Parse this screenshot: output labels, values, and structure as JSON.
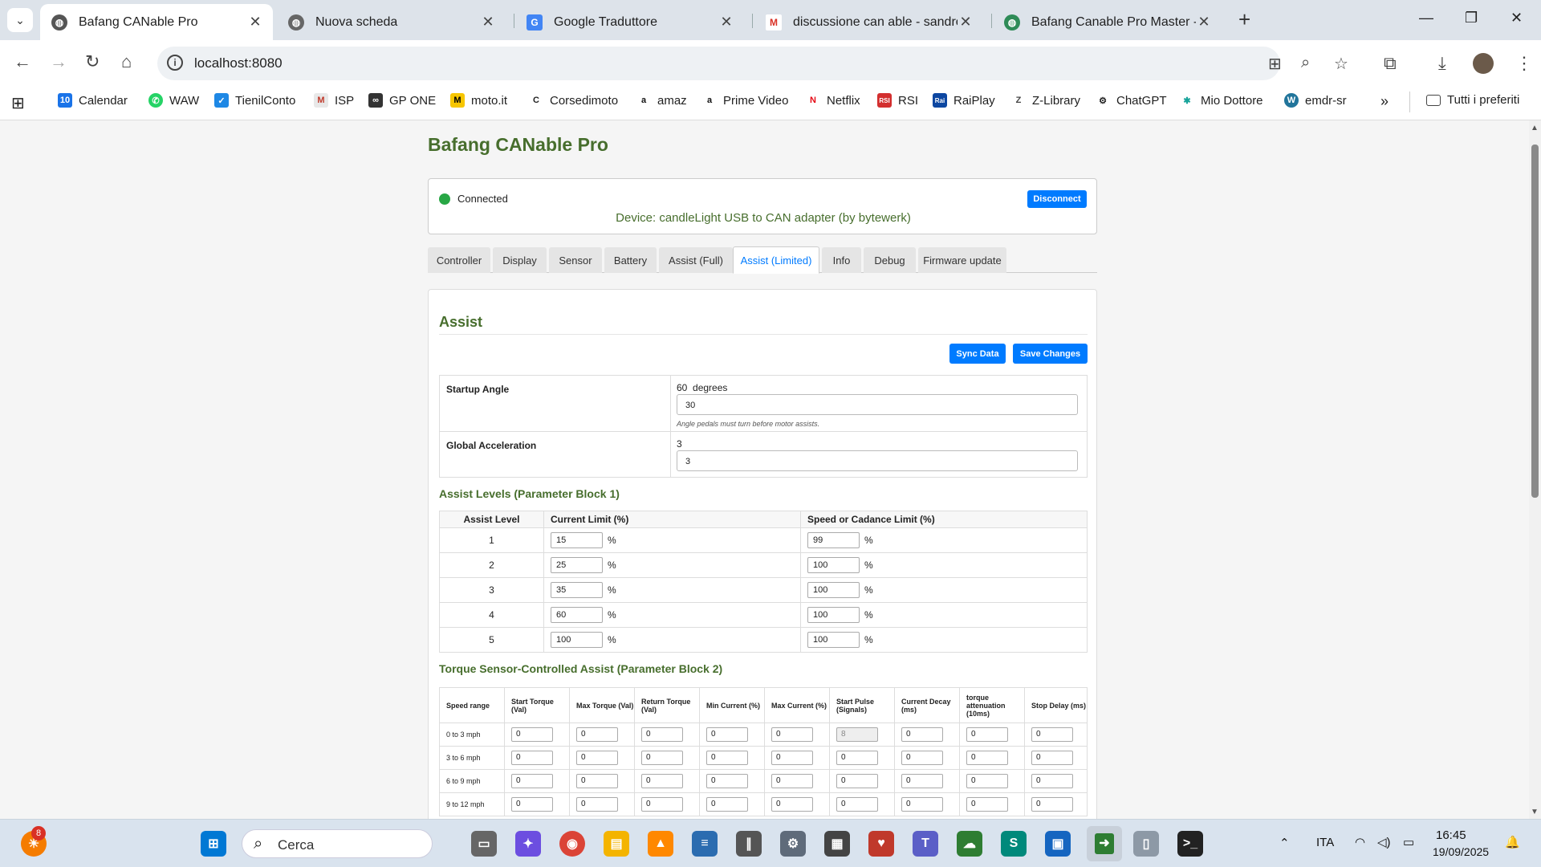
{
  "browser": {
    "tabs": [
      {
        "title": "Bafang CANable Pro",
        "active": true,
        "favicon": "globe-icon"
      },
      {
        "title": "Nuova scheda",
        "active": false,
        "favicon": "chrome-icon"
      },
      {
        "title": "Google Traduttore",
        "active": false,
        "favicon": "translate-icon"
      },
      {
        "title": "discussione can able - sandro.b",
        "active": false,
        "favicon": "gmail-icon"
      },
      {
        "title": "Bafang Canable Pro Master - di",
        "active": false,
        "favicon": "globe-icon"
      }
    ],
    "url": "localhost:8080",
    "bookmarks": [
      "Calendar",
      "WAW",
      "TienilConto",
      "ISP",
      "GP ONE",
      "moto.it",
      "Corsedimoto",
      "amaz",
      "Prime Video",
      "Netflix",
      "RSI",
      "RaiPlay",
      "Z-Library",
      "ChatGPT",
      "Mio Dottore",
      "emdr-sr"
    ],
    "all_bookmarks": "Tutti i preferiti"
  },
  "app": {
    "title": "Bafang CANable Pro",
    "status": "Connected",
    "device": "Device: candleLight USB to CAN adapter (by bytewerk)",
    "disconnect": "Disconnect",
    "tabs": [
      "Controller",
      "Display",
      "Sensor",
      "Battery",
      "Assist (Full)",
      "Assist (Limited)",
      "Info",
      "Debug",
      "Firmware update"
    ],
    "active_tab": "Assist (Limited)",
    "section_title": "Assist",
    "sync_label": "Sync Data",
    "save_label": "Save Changes",
    "startup": {
      "label": "Startup Angle",
      "current": "60  degrees",
      "value": "30",
      "hint": "Angle pedals must turn before motor assists."
    },
    "accel": {
      "label": "Global Acceleration",
      "current": "3",
      "value": "3"
    },
    "levels_title": "Assist Levels (Parameter Block 1)",
    "levels_headers": [
      "Assist Level",
      "Current Limit (%)",
      "Speed or Cadance Limit (%)"
    ],
    "levels": [
      {
        "level": "1",
        "current": "15",
        "speed": "99"
      },
      {
        "level": "2",
        "current": "25",
        "speed": "100"
      },
      {
        "level": "3",
        "current": "35",
        "speed": "100"
      },
      {
        "level": "4",
        "current": "60",
        "speed": "100"
      },
      {
        "level": "5",
        "current": "100",
        "speed": "100"
      }
    ],
    "percent": "%",
    "torque_title": "Torque Sensor-Controlled Assist (Parameter Block 2)",
    "torque_headers": [
      "Speed range",
      "Start Torque (Val)",
      "Max Torque (Val)",
      "Return Torque (Val)",
      "Min Current (%)",
      "Max Current (%)",
      "Start Pulse (Signals)",
      "Current Decay (ms)",
      "torque attenuation (10ms)",
      "Stop Delay (ms)"
    ],
    "torque_rows": [
      {
        "range": "0 to 3 mph",
        "values": [
          "0",
          "0",
          "0",
          "0",
          "0",
          "8",
          "0",
          "0",
          "0"
        ]
      },
      {
        "range": "3 to 6 mph",
        "values": [
          "0",
          "0",
          "0",
          "0",
          "0",
          "0",
          "0",
          "0",
          "0"
        ]
      },
      {
        "range": "6 to 9 mph",
        "values": [
          "0",
          "0",
          "0",
          "0",
          "0",
          "0",
          "0",
          "0",
          "0"
        ]
      },
      {
        "range": "9 to 12 mph",
        "values": [
          "0",
          "0",
          "0",
          "0",
          "0",
          "0",
          "0",
          "0",
          "0"
        ]
      }
    ]
  },
  "taskbar": {
    "search": "Cerca",
    "badge": "8",
    "lang": "ITA",
    "time": "16:45",
    "date": "19/09/2025"
  },
  "colors": {
    "accent": "#007bff",
    "heading": "#476e2d",
    "connected": "#28a745"
  }
}
